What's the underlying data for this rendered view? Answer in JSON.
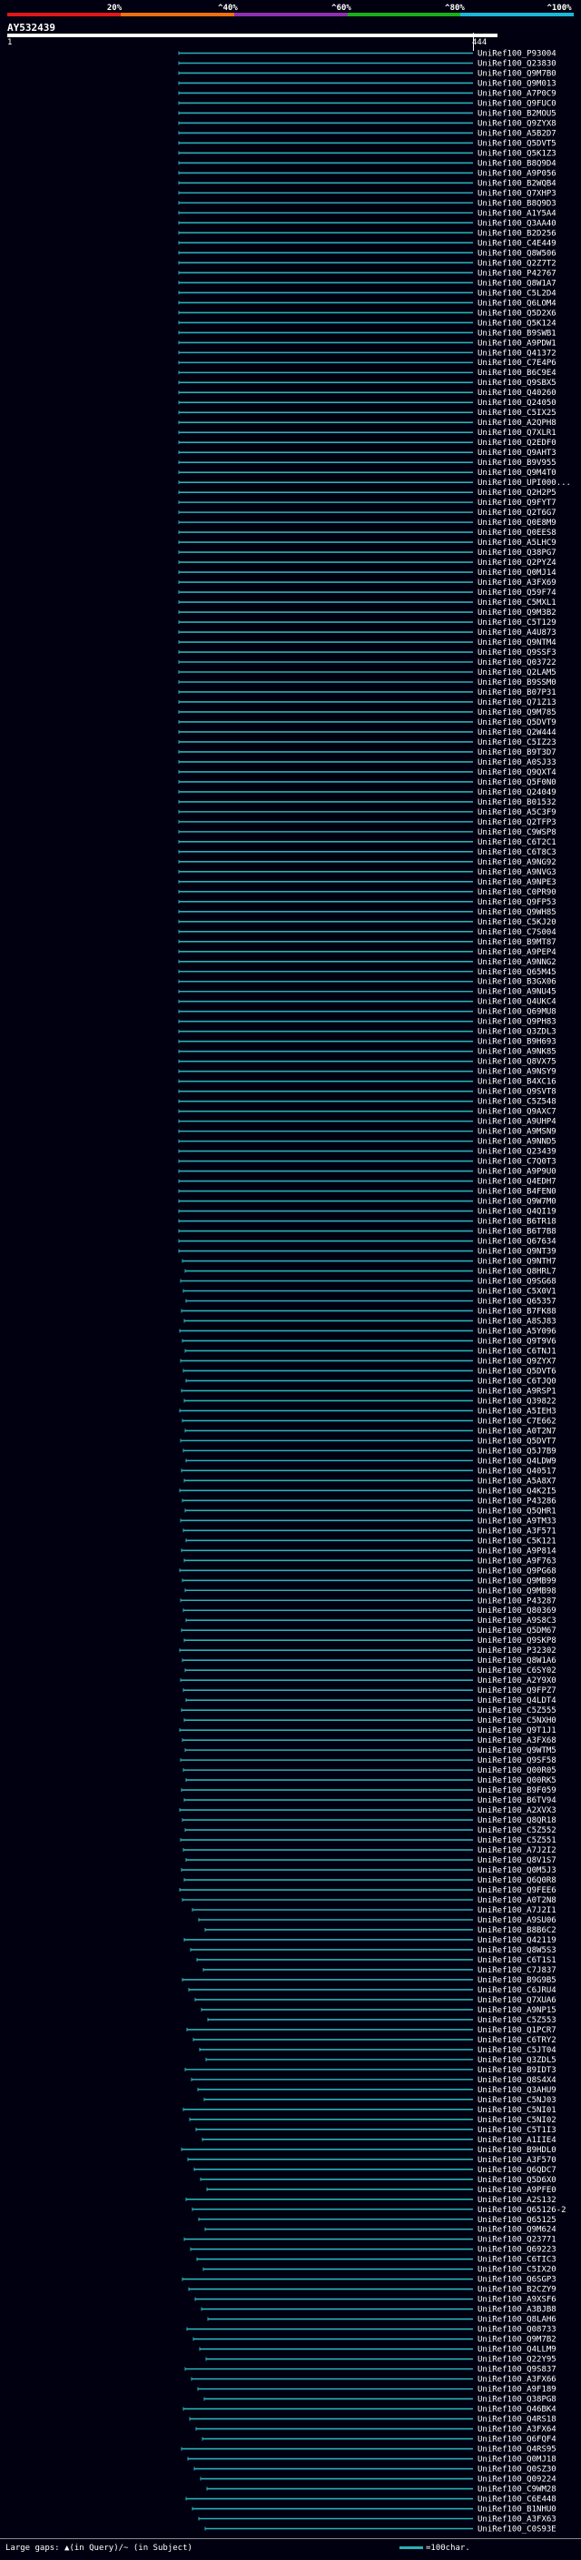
{
  "query": {
    "id": "AY532439",
    "start": "1",
    "end": "444"
  },
  "scale": {
    "labels": [
      "20%",
      "^40%",
      "^60%",
      "^80%",
      "^100%"
    ],
    "colors": [
      "#e01818",
      "#f07010",
      "#9030b0",
      "#18b018",
      "#18b8d8"
    ]
  },
  "hit_color": "#2bb0b8",
  "hits": [
    "UniRef100_P93004",
    "UniRef100_Q23830",
    "UniRef100_Q9M7B0",
    "UniRef100_Q9M013",
    "UniRef100_A7P0C9",
    "UniRef100_Q9FUC0",
    "UniRef100_B2MOU5",
    "UniRef100_Q9ZYX8",
    "UniRef100_A5B2D7",
    "UniRef100_Q5DVT5",
    "UniRef100_Q5K1Z3",
    "UniRef100_B8Q9D4",
    "UniRef100_A9P056",
    "UniRef100_B2WQB4",
    "UniRef100_Q7XHP3",
    "UniRef100_B8Q9D3",
    "UniRef100_A1Y5A4",
    "UniRef100_Q3AA40",
    "UniRef100_B2D256",
    "UniRef100_C4E449",
    "UniRef100_Q8W506",
    "UniRef100_Q2Z7T2",
    "UniRef100_P42767",
    "UniRef100_Q8W1A7",
    "UniRef100_C5L2D4",
    "UniRef100_Q6LOM4",
    "UniRef100_Q5D2X6",
    "UniRef100_Q5K124",
    "UniRef100_B9SWB1",
    "UniRef100_A9PDW1",
    "UniRef100_Q41372",
    "UniRef100_C7E4P6",
    "UniRef100_B6C9E4",
    "UniRef100_Q9SBX5",
    "UniRef100_Q40260",
    "UniRef100_Q24050",
    "UniRef100_C5IX25",
    "UniRef100_A2QPH8",
    "UniRef100_Q7XLR1",
    "UniRef100_Q2EDF0",
    "UniRef100_Q9AHT3",
    "UniRef100_B9V955",
    "UniRef100_Q9M4T0",
    "UniRef100_UPI000...",
    "UniRef100_Q2H2P5",
    "UniRef100_Q9FYT7",
    "UniRef100_Q2T6G7",
    "UniRef100_Q0E8M9",
    "UniRef100_Q0EES8",
    "UniRef100_A5LHC9",
    "UniRef100_Q38PG7",
    "UniRef100_Q2PYZ4",
    "UniRef100_Q0MJ14",
    "UniRef100_A3FX69",
    "UniRef100_Q59F74",
    "UniRef100_C5MXL1",
    "UniRef100_Q9M3B2",
    "UniRef100_C5T129",
    "UniRef100_A4U873",
    "UniRef100_Q9NTM4",
    "UniRef100_Q9SSF3",
    "UniRef100_Q03722",
    "UniRef100_Q2LAM5",
    "UniRef100_B9SSM0",
    "UniRef100_B07P31",
    "UniRef100_Q71Z13",
    "UniRef100_Q9M785",
    "UniRef100_Q5DVT9",
    "UniRef100_Q2W444",
    "UniRef100_C5IZ23",
    "UniRef100_B9T3D7",
    "UniRef100_A0SJ33",
    "UniRef100_Q9QXT4",
    "UniRef100_Q5F0N0",
    "UniRef100_Q24049",
    "UniRef100_B01532",
    "UniRef100_A5C3F9",
    "UniRef100_Q2TFP3",
    "UniRef100_C9WSP8",
    "UniRef100_C6T2C1",
    "UniRef100_C6T8C3",
    "UniRef100_A9NG92",
    "UniRef100_A9NVG3",
    "UniRef100_A9NPE3",
    "UniRef100_C0PR90",
    "UniRef100_Q9FP53",
    "UniRef100_Q9WH85",
    "UniRef100_C5KJ20",
    "UniRef100_C7S004",
    "UniRef100_B9MT87",
    "UniRef100_A9PEP4",
    "UniRef100_A9NNG2",
    "UniRef100_Q65M45",
    "UniRef100_B3GX06",
    "UniRef100_A9NU45",
    "UniRef100_Q4UKC4",
    "UniRef100_Q69MU8",
    "UniRef100_Q9PH83",
    "UniRef100_Q3ZDL3",
    "UniRef100_B9H693",
    "UniRef100_A9NK85",
    "UniRef100_Q8VX75",
    "UniRef100_A9NSY9",
    "UniRef100_B4XC16",
    "UniRef100_Q9SVT8",
    "UniRef100_C5Z548",
    "UniRef100_Q9AXC7",
    "UniRef100_A9UHP4",
    "UniRef100_A9MSN9",
    "UniRef100_A9NND5",
    "UniRef100_Q23439",
    "UniRef100_C7Q0T3",
    "UniRef100_A9P9U0",
    "UniRef100_Q4EDH7",
    "UniRef100_B4FEN0",
    "UniRef100_Q9W7M0",
    "UniRef100_Q4QI19",
    "UniRef100_B6TR18",
    "UniRef100_B6T7B8",
    "UniRef100_Q67634",
    "UniRef100_Q9NT39",
    "UniRef100_Q9NTH7",
    "UniRef100_Q8HRL7",
    "UniRef100_Q9SG68",
    "UniRef100_C5X0V1",
    "UniRef100_Q65357",
    "UniRef100_B7FK88",
    "UniRef100_A8SJ83",
    "UniRef100_A5Y096",
    "UniRef100_Q9T9V6",
    "UniRef100_C6TNJ1",
    "UniRef100_Q9ZYX7",
    "UniRef100_Q5DVT6",
    "UniRef100_C6TJQ0",
    "UniRef100_A9RSP1",
    "UniRef100_Q39822",
    "UniRef100_A5IEH3",
    "UniRef100_C7E662",
    "UniRef100_A0T2N7",
    "UniRef100_Q5DVT7",
    "UniRef100_Q5J7B9",
    "UniRef100_Q4LDW9",
    "UniRef100_Q40517",
    "UniRef100_A5A8X7",
    "UniRef100_Q4K2I5",
    "UniRef100_P43286",
    "UniRef100_Q5QHR1",
    "UniRef100_A9TM33",
    "UniRef100_A3F571",
    "UniRef100_C5K121",
    "UniRef100_A9P814",
    "UniRef100_A9F763",
    "UniRef100_Q9PG68",
    "UniRef100_Q9MB99",
    "UniRef100_Q9MB98",
    "UniRef100_P43287",
    "UniRef100_Q80369",
    "UniRef100_A9S8C3",
    "UniRef100_Q5DM67",
    "UniRef100_Q9SKP8",
    "UniRef100_P32302",
    "UniRef100_Q8W1A6",
    "UniRef100_C6SY02",
    "UniRef100_A2Y9X0",
    "UniRef100_Q9FPZ7",
    "UniRef100_Q4LDT4",
    "UniRef100_C5Z555",
    "UniRef100_C5NXH0",
    "UniRef100_Q9T1J1",
    "UniRef100_A3FX68",
    "UniRef100_Q9WTM5",
    "UniRef100_Q9SF58",
    "UniRef100_Q00R05",
    "UniRef100_Q00RK5",
    "UniRef100_B9F059",
    "UniRef100_B6TV94",
    "UniRef100_A2XVX3",
    "UniRef100_Q8QR18",
    "UniRef100_C5Z552",
    "UniRef100_C5Z551",
    "UniRef100_A7J2I2",
    "UniRef100_Q8V1S7",
    "UniRef100_Q0M5J3",
    "UniRef100_Q6Q0R8",
    "UniRef100_Q9FEE6",
    "UniRef100_A0T2N8",
    "UniRef100_A7J2I1",
    "UniRef100_A9SU06",
    "UniRef100_B8B6C2",
    "UniRef100_Q42119",
    "UniRef100_Q8W5S3",
    "UniRef100_C6T1S1",
    "UniRef100_C7J837",
    "UniRef100_B9G9B5",
    "UniRef100_C6JRU4",
    "UniRef100_Q7XUA6",
    "UniRef100_A9NP15",
    "UniRef100_C5Z553",
    "UniRef100_Q1PCR7",
    "UniRef100_C6TRY2",
    "UniRef100_C5JT04",
    "UniRef100_Q3ZDL5",
    "UniRef100_B9IDT3",
    "UniRef100_Q8S4X4",
    "UniRef100_Q3AHU9",
    "UniRef100_C5NJ03",
    "UniRef100_C5NI01",
    "UniRef100_C5NI02",
    "UniRef100_C5T1I3",
    "UniRef100_A1IIE4",
    "UniRef100_B9HDL0",
    "UniRef100_A3F570",
    "UniRef100_Q6QDC7",
    "UniRef100_Q5D6X0",
    "UniRef100_A9PFE0",
    "UniRef100_A2S132",
    "UniRef100_Q65126-2",
    "UniRef100_Q65125",
    "UniRef100_Q9M624",
    "UniRef100_Q23771",
    "UniRef100_Q69223",
    "UniRef100_C6TIC3",
    "UniRef100_C5IX20",
    "UniRef100_Q6SGP3",
    "UniRef100_B2CZY9",
    "UniRef100_A9XSF6",
    "UniRef100_A3BJB8",
    "UniRef100_Q8LAH6",
    "UniRef100_Q08733",
    "UniRef100_Q9M7B2",
    "UniRef100_Q4LLM9",
    "UniRef100_Q22Y95",
    "UniRef100_Q9S837",
    "UniRef100_A3FX66",
    "UniRef100_A9F189",
    "UniRef100_Q38PG8",
    "UniRef100_Q46BK4",
    "UniRef100_Q4RS18",
    "UniRef100_A3FX64",
    "UniRef100_Q6FQF4",
    "UniRef100_Q4RS95",
    "UniRef100_Q0MJ18",
    "UniRef100_Q0SZ30",
    "UniRef100_Q09224",
    "UniRef100_C9WM28",
    "UniRef100_C6E448",
    "UniRef100_B1NHU0",
    "UniRef100_A3FX63",
    "UniRef100_C0S93E"
  ],
  "legend": {
    "left": "Large gaps: ▲(in Query)/~ (in Subject)",
    "right": "=100char."
  }
}
